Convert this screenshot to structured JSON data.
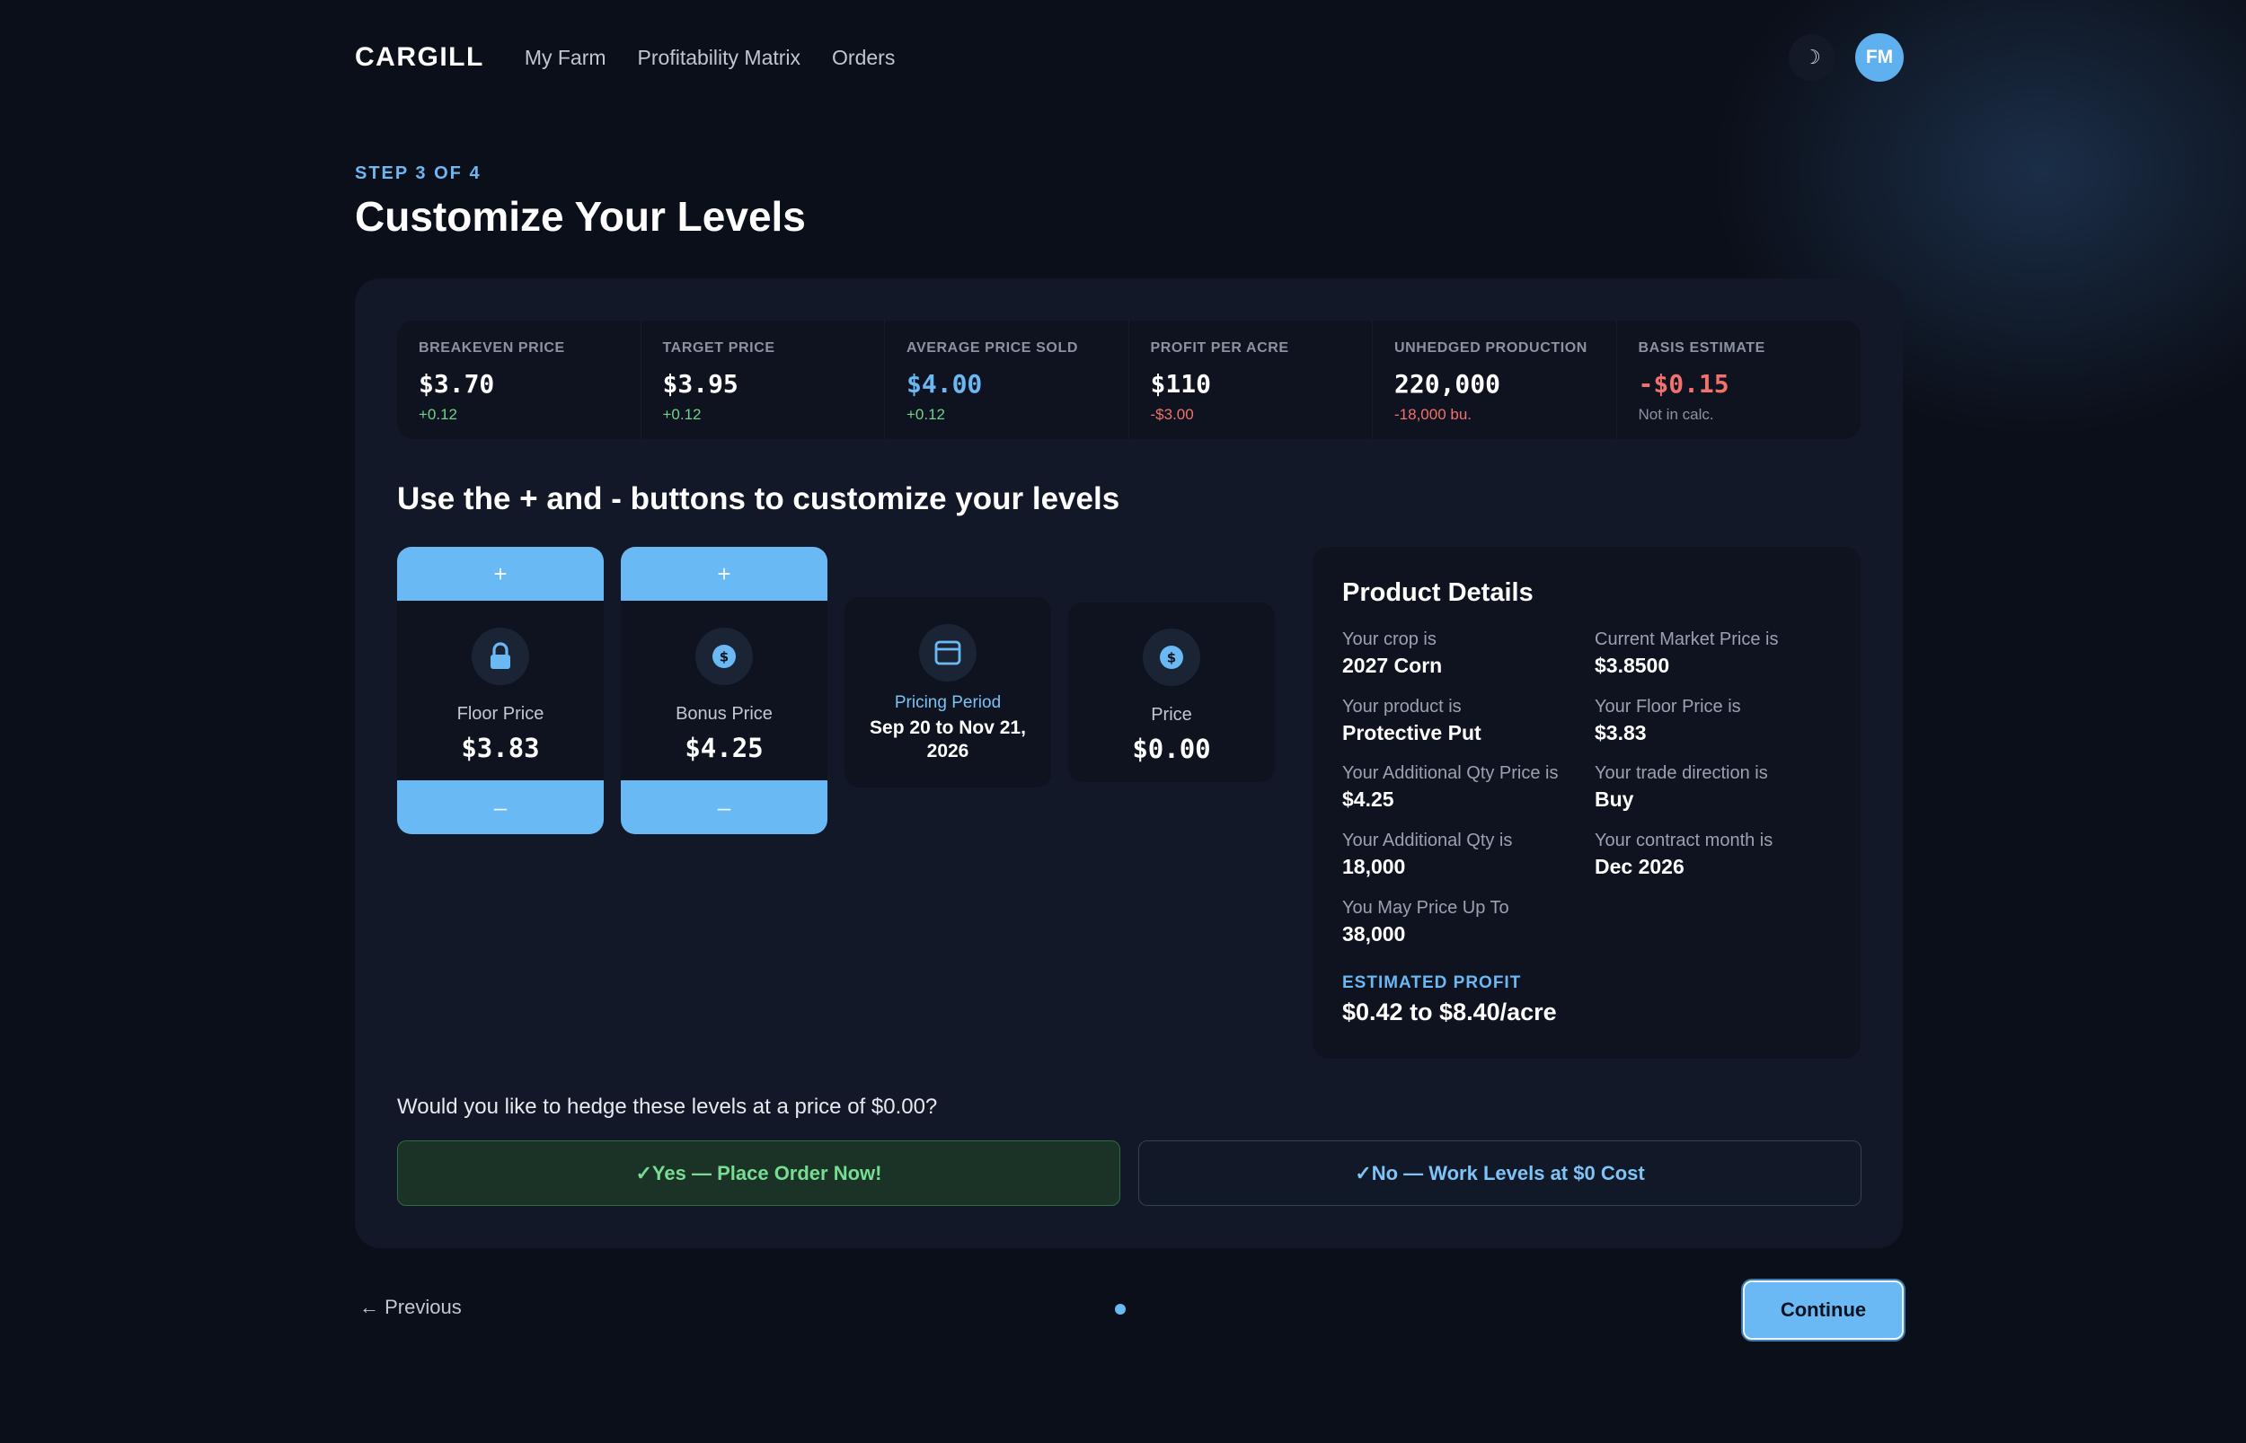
{
  "nav": {
    "brand": "CARGILL",
    "links": [
      "My Farm",
      "Profitability Matrix",
      "Orders"
    ],
    "theme_toggle_glyph": "☽",
    "avatar_initials": "FM"
  },
  "header": {
    "step": "STEP 3 OF 4",
    "title": "Customize Your Levels"
  },
  "stats": [
    {
      "label": "BREAKEVEN PRICE",
      "value": "$3.70",
      "sub": "+0.12"
    },
    {
      "label": "TARGET PRICE",
      "value": "$3.95",
      "sub": "+0.12"
    },
    {
      "label": "AVERAGE PRICE SOLD",
      "value": "$4.00",
      "sub": "+0.12"
    },
    {
      "label": "PROFIT PER ACRE",
      "value": "$110",
      "sub": "-$3.00"
    },
    {
      "label": "UNHEDGED PRODUCTION",
      "value": "220,000",
      "sub": "-18,000 bu."
    },
    {
      "label": "BASIS ESTIMATE",
      "value": "-$0.15",
      "sub": "Not in calc."
    }
  ],
  "instructions": "Use the + and - buttons to customize your levels",
  "levels": {
    "plus_label": "+",
    "minus_label": "–",
    "floor": {
      "label": "Floor Price",
      "value": "$3.83",
      "icon": "lock-icon"
    },
    "bonus": {
      "label": "Bonus Price",
      "value": "$4.25",
      "icon": "dollar-coin-icon"
    },
    "period": {
      "label": "Pricing Period",
      "value": "Sep 20 to Nov 21, 2026",
      "icon": "calendar-icon"
    },
    "price": {
      "label": "Price",
      "value": "$0.00",
      "icon": "dollar-coin-icon"
    }
  },
  "product_details": {
    "title": "Product Details",
    "items": [
      {
        "label": "Your crop is",
        "value": "2027 Corn"
      },
      {
        "label": "Current Market Price is",
        "value": "$3.8500"
      },
      {
        "label": "Your product is",
        "value": "Protective Put"
      },
      {
        "label": "Your Floor Price is",
        "value": "$3.83"
      },
      {
        "label": "Your Additional Qty Price is",
        "value": "$4.25"
      },
      {
        "label": "Your trade direction is",
        "value": "Buy"
      },
      {
        "label": "Your Additional Qty is",
        "value": "18,000"
      },
      {
        "label": "Your contract month is",
        "value": "Dec 2026"
      },
      {
        "label": "You May Price Up To",
        "value": "38,000"
      }
    ],
    "estimated_profit_label": "ESTIMATED PROFIT",
    "estimated_profit_value": "$0.42 to $8.40/acre"
  },
  "hedge": {
    "question": "Would you like to hedge these levels at a price of $0.00?",
    "yes_label": "✓Yes — Place Order Now!",
    "no_label": "✓No — Work Levels at $0 Cost"
  },
  "footer": {
    "previous_label": "← Previous",
    "continue_label": "Continue"
  },
  "colors": {
    "background": "#0b0f19",
    "card": "#121827",
    "accent": "#6ab9f4",
    "positive": "#6dd48c",
    "negative": "#f2726b"
  }
}
